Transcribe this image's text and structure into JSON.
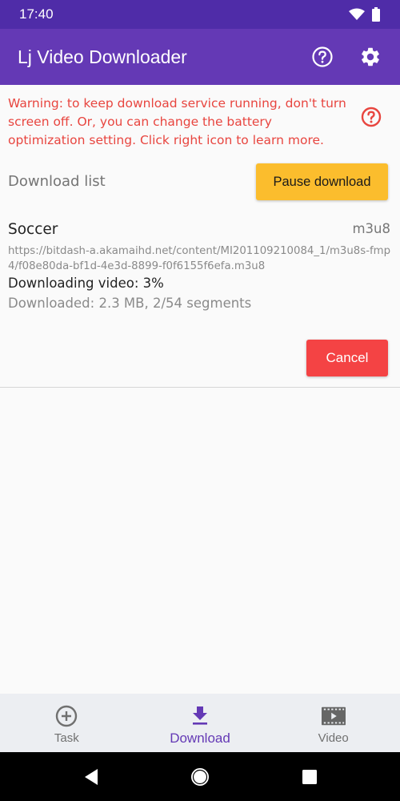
{
  "status_bar": {
    "time": "17:40",
    "icons": [
      "wifi-icon",
      "battery-icon"
    ]
  },
  "app_bar": {
    "title": "Lj Video Downloader",
    "actions": [
      {
        "name": "help-icon"
      },
      {
        "name": "gear-icon"
      }
    ]
  },
  "warning": {
    "text": "Warning: to keep download service running, don't turn screen off. Or, you can change the battery optimization setting. Click right icon to learn more.",
    "icon": "help-icon",
    "color": "#e8453f"
  },
  "download_list": {
    "label": "Download list",
    "pause_button": "Pause download",
    "items": [
      {
        "title": "Soccer",
        "type": "m3u8",
        "url": "https://bitdash-a.akamaihd.net/content/MI201109210084_1/m3u8s-fmp4/f08e80da-bf1d-4e3d-8899-f0f6155f6efa.m3u8",
        "status": "Downloading video: 3%",
        "progress": "Downloaded: 2.3 MB, 2/54 segments",
        "cancel_button": "Cancel"
      }
    ]
  },
  "bottom_nav": {
    "items": [
      {
        "label": "Task",
        "icon": "add-circle-icon",
        "active": false
      },
      {
        "label": "Download",
        "icon": "download-icon",
        "active": true
      },
      {
        "label": "Video",
        "icon": "film-icon",
        "active": false
      }
    ]
  },
  "colors": {
    "primary": "#6439b5",
    "primary_dark": "#4f2ca8",
    "pause_button": "#fbbd2d",
    "cancel_button": "#f44344"
  }
}
